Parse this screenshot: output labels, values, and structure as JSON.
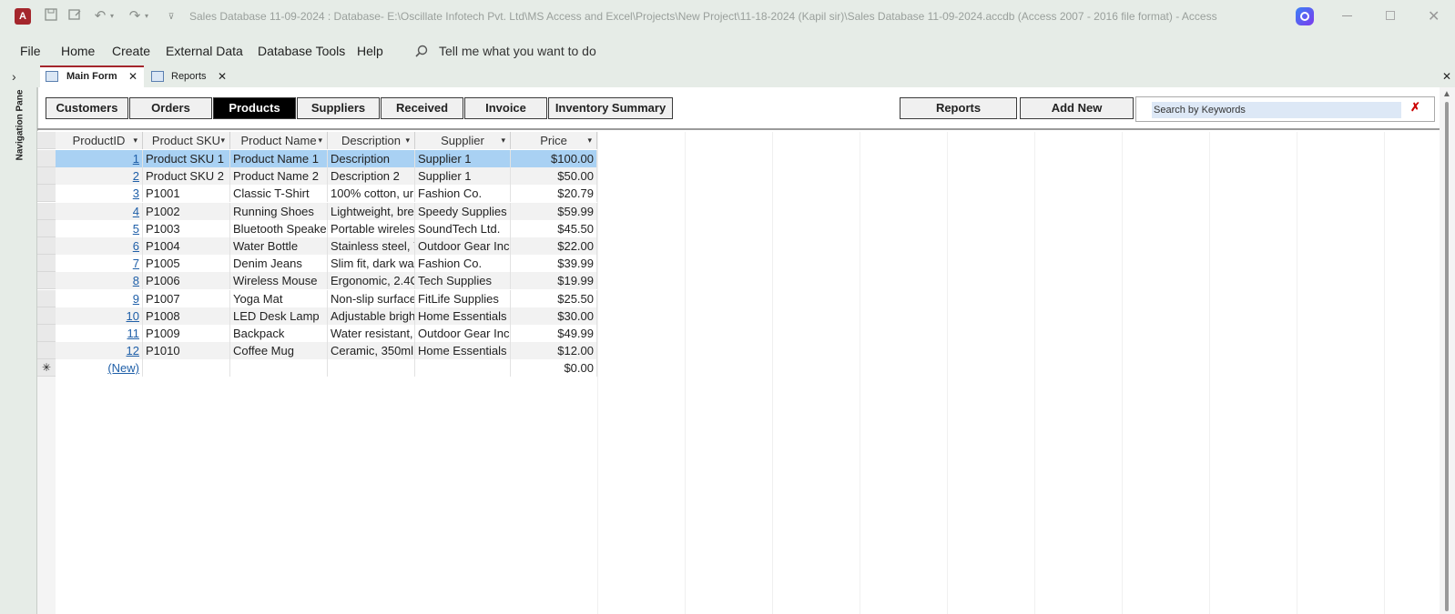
{
  "app": {
    "title": "Sales Database 11-09-2024 : Database- E:\\Oscillate Infotech Pvt. Ltd\\MS Access and Excel\\Projects\\New Project\\11-18-2024 (Kapil sir)\\Sales Database 11-09-2024.accdb (Access 2007 - 2016 file format)  -  Access",
    "logo": "A"
  },
  "menu": {
    "items": [
      "File",
      "Home",
      "Create",
      "External Data",
      "Database Tools",
      "Help"
    ],
    "tell_me": "Tell me what you want to do"
  },
  "nav_pane": {
    "label": "Navigation Pane"
  },
  "doc_tabs": [
    {
      "label": "Main Form"
    },
    {
      "label": "Reports"
    }
  ],
  "form": {
    "buttons": [
      "Customers",
      "Orders",
      "Products",
      "Suppliers",
      "Received",
      "Invoice",
      "Inventory Summary"
    ],
    "active_button": "Products",
    "reports_label": "Reports",
    "add_new_label": "Add New",
    "search_placeholder": "Search by Keywords"
  },
  "table": {
    "columns": [
      "ProductID",
      "Product SKU",
      "Product Name",
      "Description",
      "Supplier",
      "Price"
    ],
    "rows": [
      [
        "1",
        "Product SKU 1",
        "Product Name 1",
        "Description",
        "Supplier 1",
        "$100.00"
      ],
      [
        "2",
        "Product SKU 2",
        "Product Name 2",
        "Description 2",
        "Supplier 1",
        "$50.00"
      ],
      [
        "3",
        "P1001",
        "Classic T-Shirt",
        "100% cotton, ur",
        "Fashion Co.",
        "$20.79"
      ],
      [
        "4",
        "P1002",
        "Running Shoes",
        "Lightweight, bre",
        "Speedy Supplies",
        "$59.99"
      ],
      [
        "5",
        "P1003",
        "Bluetooth Speake",
        "Portable wireles",
        "SoundTech Ltd.",
        "$45.50"
      ],
      [
        "6",
        "P1004",
        "Water Bottle",
        "Stainless steel, 7",
        "Outdoor Gear Inc",
        "$22.00"
      ],
      [
        "7",
        "P1005",
        "Denim Jeans",
        "Slim fit, dark wa",
        "Fashion Co.",
        "$39.99"
      ],
      [
        "8",
        "P1006",
        "Wireless Mouse",
        "Ergonomic, 2.4C",
        "Tech Supplies",
        "$19.99"
      ],
      [
        "9",
        "P1007",
        "Yoga Mat",
        "Non-slip surface",
        "FitLife Supplies",
        "$25.50"
      ],
      [
        "10",
        "P1008",
        "LED Desk Lamp",
        "Adjustable brigh",
        "Home Essentials",
        "$30.00"
      ],
      [
        "11",
        "P1009",
        "Backpack",
        "Water resistant,",
        "Outdoor Gear Inc",
        "$49.99"
      ],
      [
        "12",
        "P1010",
        "Coffee Mug",
        "Ceramic, 350ml,",
        "Home Essentials",
        "$12.00"
      ]
    ],
    "new_row": {
      "id": "(New)",
      "price": "$0.00"
    },
    "selected_row": 0
  },
  "colors": {
    "accent": "#a4262c",
    "selection": "#a9d1f3",
    "link": "#1f5fa8"
  }
}
